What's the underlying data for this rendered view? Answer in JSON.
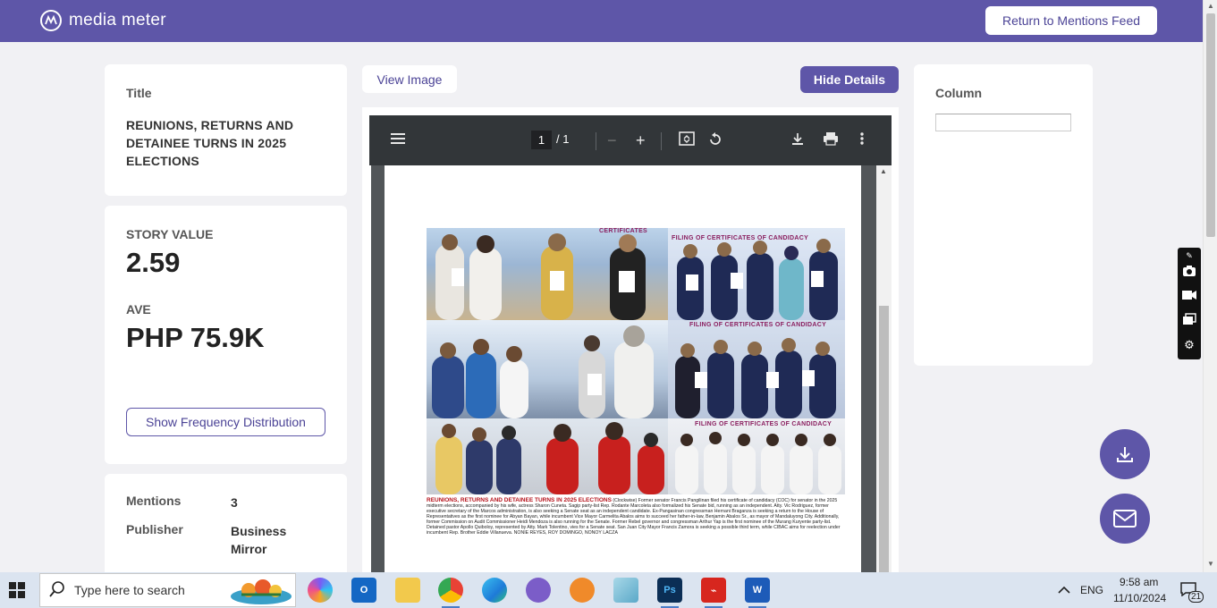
{
  "header": {
    "brand": "media meter",
    "return_button": "Return to Mentions Feed"
  },
  "left": {
    "title_label": "Title",
    "title_value": "REUNIONS, RETURNS AND DETAINEE TURNS IN 2025 ELECTIONS",
    "story_value_label": "STORY VALUE",
    "story_value": "2.59",
    "ave_label": "AVE",
    "ave_value": "PHP 75.9K",
    "freq_button": "Show Frequency Distribution",
    "mentions_label": "Mentions",
    "mentions_value": "3",
    "publisher_label": "Publisher",
    "publisher_value": "Business Mirror"
  },
  "center": {
    "view_image_button": "View Image",
    "hide_details_button": "Hide Details",
    "pdf": {
      "current_page": "1",
      "total_pages": "/ 1"
    },
    "clipping": {
      "banner_1": "FILING OF CERTIFICATES OF CANDIDACY",
      "banner_2": "FILING OF CERTIFICATES OF CANDIDACY",
      "banner_3": "FILING OF CERTIFICATES OF CANDIDACY",
      "banner_top": "CERTIFICATES",
      "caption_headline": "REUNIONS, RETURNS AND DETAINEE TURNS IN 2025 ELECTIONS",
      "caption_body": "(Clockwise) Former senator Francis Pangilinan filed his certificate of candidacy (COC) for senator in the 2025 midterm elections, accompanied by his wife, actress Sharon Cuneta. Sagip party-list Rep. Rodante Marcoleta also formalized his Senate bid, running as an independent. Atty. Vic Rodriguez, former executive secretary of the Marcos administration, is also seeking a Senate seat as an independent candidate. Ex-Pangasinan congressman Hernani Braganza is seeking a return to the House of Representatives as the first nominee for Abyan Bayan, while incumbent Vice Mayor Carmelita Abalos aims to succeed her father-in-law, Benjamin Abalos Sr., as mayor of Mandaluyong City. Additionally, former Commission on Audit Commissioner Heidi Mendoza is also running for the Senate. Former Rebel governor and congressman Arthur Yap is the first nominee of the Murang Kuryente party-list. Detained pastor Apollo Quiboloy, represented by Atty. Mark Tolentino, vies for a Senate seat. San Juan City Mayor Francis Zamora is seeking a possible third term, while CIBAC aims for reelection under incumbent Rep. Brother Eddie Villanueva. NONIE REYES, ROY DOMINGO, NONOY LACZA"
    }
  },
  "right": {
    "column_label": "Column"
  },
  "taskbar": {
    "search_placeholder": "Type here to search",
    "language": "ENG",
    "time": "9:58 am",
    "date": "11/10/2024",
    "notification_count": "21"
  },
  "colors": {
    "brand": "#5e56a8",
    "taskbar": "#dbe4f0",
    "pdf_toolbar": "#323639"
  }
}
